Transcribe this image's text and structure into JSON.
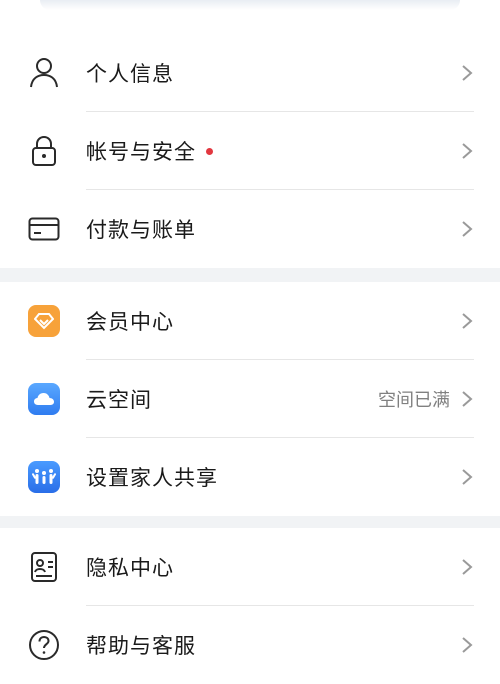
{
  "group_account": {
    "items": [
      {
        "label": "个人信息",
        "icon": "person-icon"
      },
      {
        "label": "帐号与安全",
        "icon": "lock-icon",
        "has_alert_dot": true
      },
      {
        "label": "付款与账单",
        "icon": "card-icon"
      }
    ]
  },
  "group_services": {
    "items": [
      {
        "label": "会员中心",
        "icon": "diamond-icon"
      },
      {
        "label": "云空间",
        "icon": "cloud-icon",
        "status": "空间已满"
      },
      {
        "label": "设置家人共享",
        "icon": "family-icon"
      }
    ]
  },
  "group_help": {
    "items": [
      {
        "label": "隐私中心",
        "icon": "privacy-card-icon"
      },
      {
        "label": "帮助与客服",
        "icon": "question-icon"
      }
    ]
  },
  "colors": {
    "alert_dot": "#e2373f",
    "member_orange": "#f7a23a",
    "cloud_blue": "#3a8cf5",
    "family_blue": "#2f7cf0"
  }
}
